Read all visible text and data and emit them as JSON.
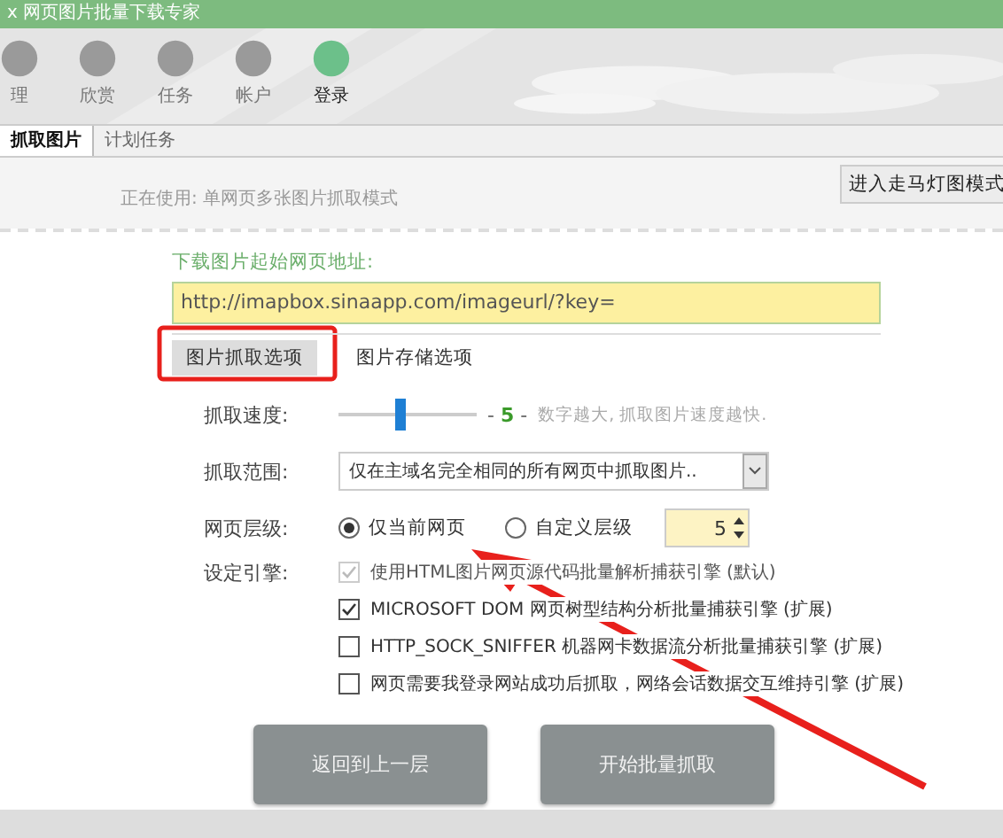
{
  "window": {
    "title": "x 网页图片批量下载专家"
  },
  "menu": [
    {
      "label": "理",
      "selected": false
    },
    {
      "label": "欣赏",
      "selected": false
    },
    {
      "label": "任务",
      "selected": false
    },
    {
      "label": "帐户",
      "selected": false
    },
    {
      "label": "登录",
      "selected": true
    }
  ],
  "tabs": [
    {
      "label": "抓取图片",
      "selected": true
    },
    {
      "label": "计划任务",
      "selected": false
    }
  ],
  "status": "正在使用: 单网页多张图片抓取模式",
  "mode_button": "进入走马灯图模式",
  "url": {
    "label": "下载图片起始网页地址:",
    "value": "http://imapbox.sinaapp.com/imageurl/?key="
  },
  "option_tabs": [
    {
      "label": "图片抓取选项",
      "selected": true
    },
    {
      "label": "图片存储选项",
      "selected": false
    }
  ],
  "speed": {
    "label": "抓取速度:",
    "level": 0.45,
    "value": "- **5** -",
    "hint": "数字越大, 抓取图片速度越快."
  },
  "range": {
    "label": "抓取范围:",
    "value": "仅在主域名完全相同的所有网页中抓取图片.."
  },
  "depth": {
    "label": "网页层级:",
    "options": [
      {
        "label": "仅当前网页",
        "selected": true
      },
      {
        "label": "自定义层级",
        "selected": false
      }
    ],
    "value": "5"
  },
  "engines": {
    "label": "设定引擎:",
    "items": [
      {
        "label": "使用HTML图片网页源代码批量解析捕获引擎 (默认)",
        "checked": true,
        "disabled": true
      },
      {
        "label": "MICROSOFT DOM 网页树型结构分析批量捕获引擎 (扩展)",
        "checked": true,
        "disabled": false
      },
      {
        "label": "HTTP_SOCK_SNIFFER 机器网卡数据流分析批量捕获引擎 (扩展)",
        "checked": false,
        "disabled": false
      },
      {
        "label": "网页需要我登录网站成功后抓取，网络会话数据交互维持引擎 (扩展)",
        "checked": false,
        "disabled": false
      }
    ]
  },
  "buttons": [
    "返回到上一层",
    "开始批量抓取"
  ]
}
